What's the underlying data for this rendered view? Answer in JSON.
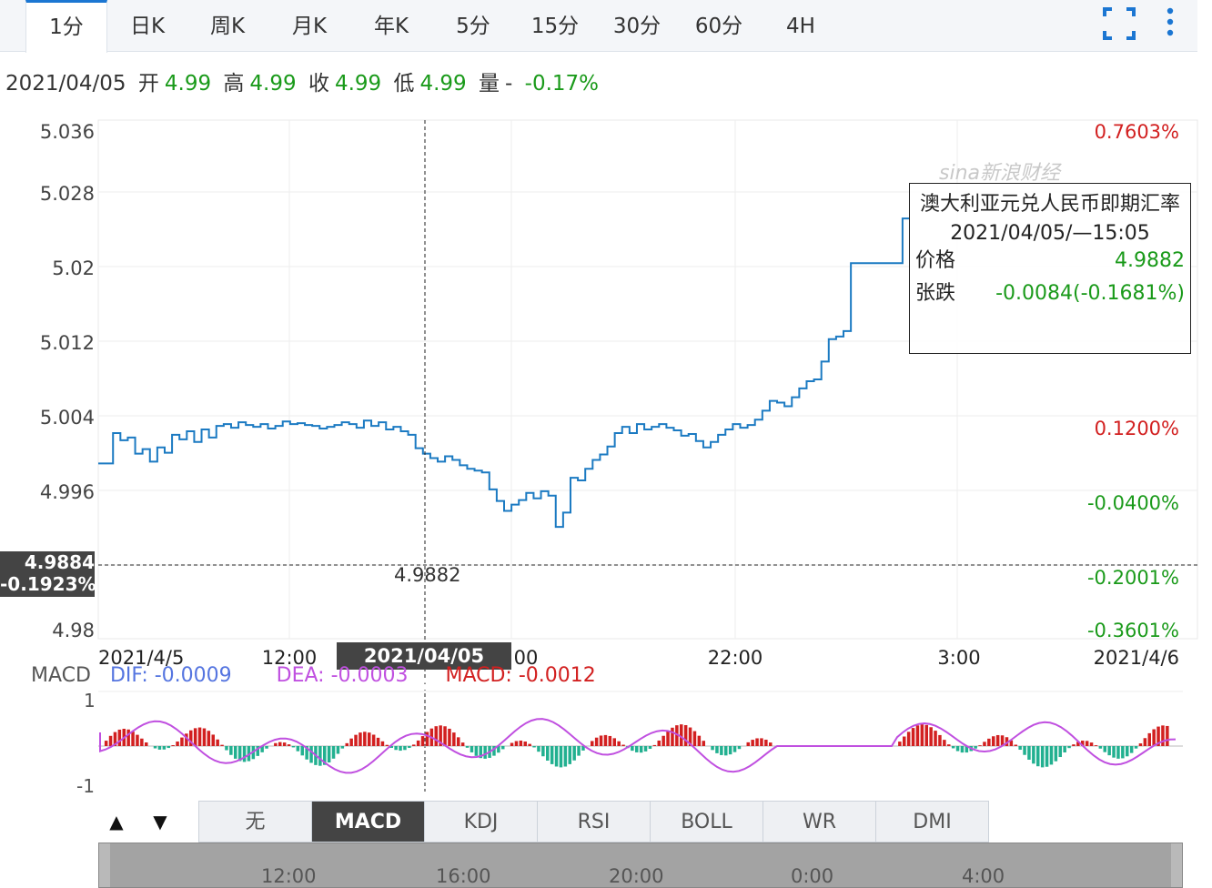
{
  "tabs": [
    "1分",
    "日K",
    "周K",
    "月K",
    "年K",
    "5分",
    "15分",
    "30分",
    "60分",
    "4H"
  ],
  "active_tab": 0,
  "icons": {
    "fullscreen": "fullscreen-icon",
    "more": "more-vertical-icon"
  },
  "info": {
    "date": "2021/04/05",
    "open_label": "开",
    "open": "4.99",
    "high_label": "高",
    "high": "4.99",
    "close_label": "收",
    "close": "4.99",
    "low_label": "低",
    "low": "4.99",
    "vol_label": "量",
    "vol": "-",
    "change": "-0.17%"
  },
  "tooltip": {
    "title": "澳大利亚元兑人民币即期汇率",
    "time": "2021/04/05/—15:05",
    "price_label": "价格",
    "price": "4.9882",
    "change_label": "张跌",
    "change": "-0.0084(-0.1681%)"
  },
  "cursor": {
    "price_label": "4.9884",
    "pct_label": "-0.1923%",
    "point_label": "4.9882",
    "time_label": "2021/04/05 15:05"
  },
  "watermark": "sina新浪财经",
  "colors": {
    "line": "#1b7ac2",
    "up": "#d22020",
    "down": "#1a9a1a",
    "dif": "#5575e0",
    "dea": "#c050e0",
    "macd_neg": "#22b090"
  },
  "chart_data": {
    "type": "line",
    "title": "澳大利亚元兑人民币即期汇率",
    "ylim": [
      4.978,
      5.036
    ],
    "y_ticks": [
      "5.036",
      "5.028",
      "5.02",
      "5.012",
      "5.004",
      "4.996",
      "4.98"
    ],
    "pct_ticks": [
      "0.7603%",
      "0.1200%",
      "-0.0400%",
      "-0.2001%",
      "-0.3601%"
    ],
    "x_ticks": [
      "2021/4/5",
      "12:00",
      "00",
      "22:00",
      "3:00",
      "2021/4/6"
    ],
    "series": [
      {
        "values": [
          4.9976,
          4.9976,
          5.001,
          5.0002,
          5.0005,
          4.9987,
          4.9992,
          4.9978,
          4.9994,
          4.9988,
          5.0008,
          5.0003,
          5.0012,
          5.0,
          5.0014,
          5.0005,
          5.0018,
          5.002,
          5.0016,
          5.0022,
          5.0019,
          5.0017,
          5.002,
          5.0015,
          5.0018,
          5.0023,
          5.002,
          5.0021,
          5.0019,
          5.0018,
          5.0015,
          5.0017,
          5.0019,
          5.0022,
          5.002,
          5.0016,
          5.0024,
          5.0018,
          5.0022,
          5.0014,
          5.0017,
          5.0012,
          5.0008,
          4.9993,
          4.9987,
          4.9982,
          4.9978,
          4.9984,
          4.998,
          4.9974,
          4.997,
          4.9968,
          4.9966,
          4.9947,
          4.9934,
          4.9923,
          4.993,
          4.9935,
          4.9943,
          4.9937,
          4.9945,
          4.994,
          4.9905,
          4.9921,
          4.996,
          4.9957,
          4.997,
          4.998,
          4.9986,
          4.9995,
          5.001,
          5.0017,
          5.001,
          5.002,
          5.0014,
          5.0017,
          5.002,
          5.0016,
          5.0013,
          5.0007,
          5.0009,
          5.0001,
          4.9994,
          5.0,
          5.0008,
          5.0014,
          5.002,
          5.0016,
          5.0019,
          5.0025,
          5.0035,
          5.0046,
          5.0044,
          5.004,
          5.005,
          5.006,
          5.0068,
          5.007,
          5.009,
          5.0115,
          5.0118,
          5.0124,
          5.02,
          5.02,
          5.02,
          5.02,
          5.02,
          5.02,
          5.02,
          5.025,
          5.025
        ]
      }
    ]
  },
  "macd": {
    "label": "MACD",
    "dif": "DIF: -0.0009",
    "dea": "DEA: -0.0003",
    "macd": "MACD: -0.0012",
    "y_ticks": [
      "1",
      "-1"
    ]
  },
  "indicators": [
    "无",
    "MACD",
    "KDJ",
    "RSI",
    "BOLL",
    "WR",
    "DMI"
  ],
  "active_indicator": 1,
  "nav_ticks": [
    "12:00",
    "16:00",
    "20:00",
    "0:00",
    "4:00"
  ]
}
